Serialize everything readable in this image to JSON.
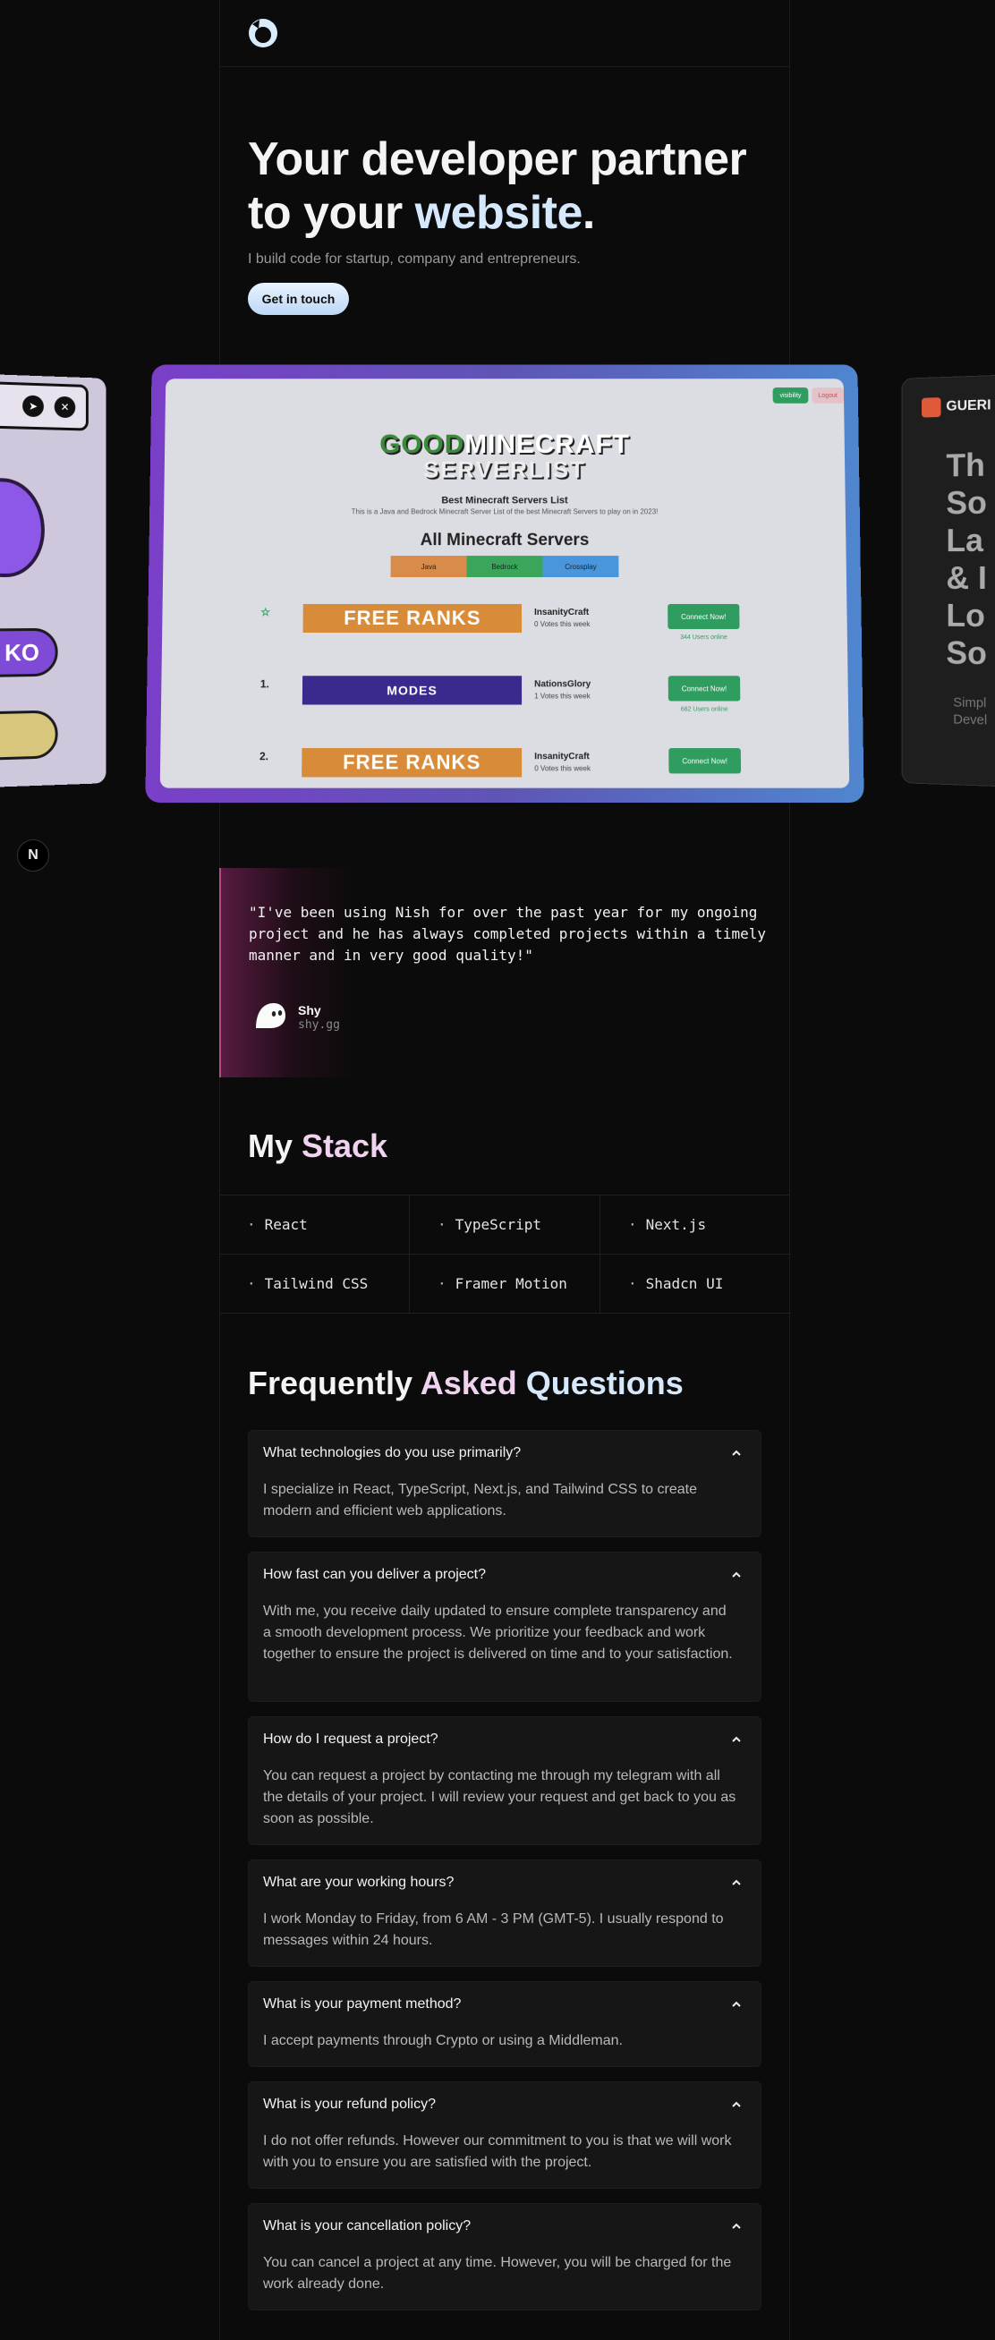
{
  "hero": {
    "title_line1": "Your developer partner",
    "title_line2_prefix": "to your ",
    "title_line2_accent": "website",
    "title_line2_suffix": ".",
    "subtitle": "I build code for startup, company and entrepreneurs.",
    "cta_label": "Get in touch"
  },
  "carousel": {
    "left_card": {
      "button_text": "KO"
    },
    "main_card": {
      "logo_line1_a": "GOOD",
      "logo_line1_b": "MINECRAFT",
      "logo_line2": "SERVERLIST",
      "heading": "Best Minecraft Servers List",
      "description": "This is a Java and Bedrock Minecraft Server List of the best Minecraft Servers to play on in 2023!",
      "section_title": "All Minecraft Servers",
      "tabs": [
        "Java",
        "Bedrock",
        "Crossplay"
      ],
      "top_buttons": [
        "visibility",
        "Logout"
      ],
      "rows": [
        {
          "rank": "☆",
          "banner": "FREE RANKS",
          "name": "InsanityCraft",
          "votes": "0 Votes this week",
          "button": "Connect Now!",
          "online": "344 Users online"
        },
        {
          "rank": "1.",
          "banner": "MODES",
          "name": "NationsGlory",
          "votes": "1 Votes this week",
          "button": "Connect Now!",
          "online": "682 Users online"
        },
        {
          "rank": "2.",
          "banner": "FREE RANKS",
          "name": "InsanityCraft",
          "votes": "0 Votes this week",
          "button": "Connect Now!",
          "online": ""
        }
      ]
    },
    "right_card": {
      "brand": "GUERI",
      "big_text": [
        "Th",
        "So",
        "La",
        "& I",
        "Lo",
        "So"
      ],
      "small_text": [
        "Simpl",
        "Devel"
      ]
    }
  },
  "n_badge": "N",
  "testimonial": {
    "quote": "\"I've been using Nish for over the past year for my ongoing project and he has always completed projects within a timely manner and in very good quality!\"",
    "author_name": "Shy",
    "author_handle": "shy.gg"
  },
  "stack": {
    "title_a": "My ",
    "title_b": "Stack",
    "items": [
      "React",
      "TypeScript",
      "Next.js",
      "Tailwind CSS",
      "Framer Motion",
      "Shadcn UI"
    ]
  },
  "faq": {
    "title_a": "Frequently ",
    "title_b": "Asked ",
    "title_c": "Questions",
    "items": [
      {
        "q": "What technologies do you use primarily?",
        "a": "I specialize in React, TypeScript, Next.js, and Tailwind CSS to create modern and efficient web applications."
      },
      {
        "q": "How fast can you deliver a project?",
        "a": "With me, you receive daily updated to ensure complete transparency and a smooth development process. We prioritize your feedback and work together to ensure the project is delivered on time and to your satisfaction."
      },
      {
        "q": "How do I request a project?",
        "a": "You can request a project by contacting me through my telegram with all the details of your project. I will review your request and get back to you as soon as possible."
      },
      {
        "q": "What are your working hours?",
        "a": "I work Monday to Friday, from 6 AM - 3 PM (GMT-5). I usually respond to messages within 24 hours."
      },
      {
        "q": "What is your payment method?",
        "a": "I accept payments through Crypto or using a Middleman."
      },
      {
        "q": "What is your refund policy?",
        "a": "I do not offer refunds. However our commitment to you is that we will work with you to ensure you are satisfied with the project."
      },
      {
        "q": "What is your cancellation policy?",
        "a": "You can cancel a project at any time. However, you will be charged for the work already done."
      }
    ]
  },
  "colors": {
    "accent_blue": "#d6e8fb",
    "accent_pink": "#f0d3ee",
    "background": "#0b0b0b"
  }
}
